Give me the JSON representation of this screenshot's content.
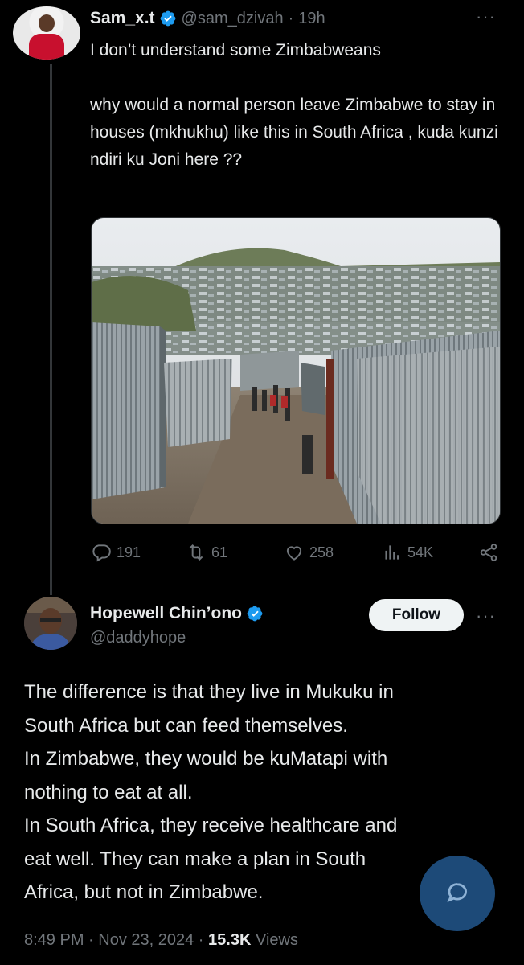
{
  "tweet": {
    "author_name": "Sam_x.t",
    "author_handle": "@sam_dzivah",
    "separator": "·",
    "time": "19h",
    "more": "···",
    "text_line1": "I don’t understand some Zimbabweans",
    "text_line2": "why would a normal person leave Zimbabwe to stay in houses (mkhukhu) like this in South Africa , kuda kunzi ndiri ku Joni here ??",
    "media_icon": "photo-of-informal-settlement",
    "stats": {
      "replies": "191",
      "retweets": "61",
      "likes": "258",
      "views": "54K"
    }
  },
  "reply": {
    "author_name": "Hopewell Chin’ono",
    "author_handle": "@daddyhope",
    "follow_label": "Follow",
    "more": "···",
    "lines": [
      "The difference is that they live in Mukuku in",
      "South Africa but can feed themselves.",
      "In Zimbabwe, they would be kuMatapi with",
      "nothing to eat at all.",
      "In South Africa, they receive healthcare and",
      "eat well. They can make a plan in South",
      "Africa, but not in Zimbabwe."
    ],
    "meta": {
      "time": "8:49 PM",
      "sep1": " · ",
      "date": "Nov 23, 2024",
      "sep2": " · ",
      "views_count": "15.3K",
      "views_label": " Views"
    }
  },
  "colors": {
    "background": "#000000",
    "text": "#e7e9ea",
    "muted": "#71767b",
    "verified": "#1d9bf0",
    "fab": "#1d4a78"
  }
}
